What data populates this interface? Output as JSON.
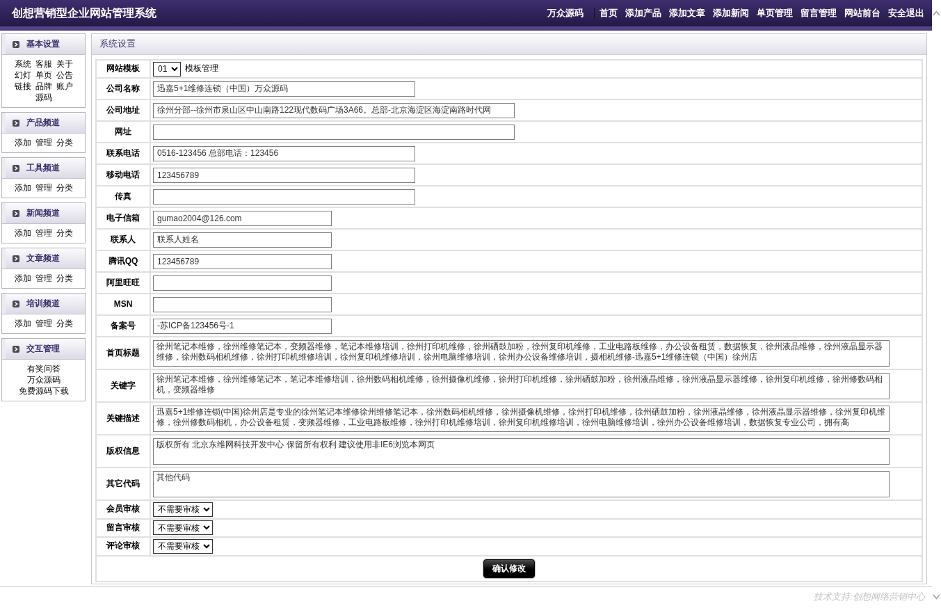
{
  "header": {
    "title": "创想营销型企业网站管理系统",
    "site_link": "万众源码",
    "nav": [
      "首页",
      "添加产品",
      "添加文章",
      "添加新闻",
      "单页管理",
      "留言管理",
      "网站前台",
      "安全退出"
    ]
  },
  "sidebar": [
    {
      "title": "基本设置",
      "links": [
        "系统",
        "客服",
        "关于",
        "幻灯",
        "单页",
        "公告",
        "链接",
        "品牌",
        "账户",
        "源码"
      ]
    },
    {
      "title": "产品频道",
      "links": [
        "添加",
        "管理",
        "分类"
      ]
    },
    {
      "title": "工具频道",
      "links": [
        "添加",
        "管理",
        "分类"
      ]
    },
    {
      "title": "新闻频道",
      "links": [
        "添加",
        "管理",
        "分类"
      ]
    },
    {
      "title": "文章频道",
      "links": [
        "添加",
        "管理",
        "分类"
      ]
    },
    {
      "title": "培训频道",
      "links": [
        "添加",
        "管理",
        "分类"
      ]
    },
    {
      "title": "交互管理",
      "links": [
        "有奖问答",
        "万众源码",
        "免费源码下载"
      ]
    }
  ],
  "panel": {
    "title": "系统设置",
    "fields": [
      {
        "label": "网站模板",
        "kind": "select",
        "value": "01",
        "link": "模板管理"
      },
      {
        "label": "公司名称",
        "kind": "input",
        "value": "迅嘉5+1维修连锁（中国）万众源码"
      },
      {
        "label": "公司地址",
        "kind": "input",
        "value": "徐州分部--徐州市泉山区中山南路122现代数码广场3A66。总部-北京海淀区海淀南路时代网"
      },
      {
        "label": "网址",
        "kind": "input"
      },
      {
        "label": "联系电话",
        "kind": "input",
        "value": "0516-123456 总部电话：123456"
      },
      {
        "label": "移动电话",
        "kind": "input",
        "value": "123456789"
      },
      {
        "label": "传真",
        "kind": "input"
      },
      {
        "label": "电子信箱",
        "kind": "input",
        "value": "gumao2004@126.com"
      },
      {
        "label": "联系人",
        "kind": "input",
        "value": "联系人姓名"
      },
      {
        "label": "腾讯QQ",
        "kind": "input",
        "value": "123456789"
      },
      {
        "label": "阿里旺旺",
        "kind": "input"
      },
      {
        "label": "MSN",
        "kind": "input"
      },
      {
        "label": "备案号",
        "kind": "input",
        "value": "-苏ICP备123456号-1"
      },
      {
        "label": "首页标题",
        "kind": "textarea",
        "value": "徐州笔记本维修，徐州维修笔记本，变频器维修，笔记本维修培训，徐州打印机维修，徐州硒鼓加粉，徐州复印机维修，工业电路板维修，办公设备租赁，数据恢复，徐州液晶维修，徐州液晶显示器维修，徐州数码相机维修，徐州打印机维修培训，徐州复印机维修培训，徐州电脑维修培训，徐州办公设备维修培训，摄相机维修-迅嘉5+1维修连锁（中国）徐州店"
      },
      {
        "label": "关键字",
        "kind": "textarea",
        "value": "徐州笔记本维修，徐州维修笔记本，笔记本维修培训，徐州数码相机维修，徐州摄像机维修，徐州打印机维修，徐州硒鼓加粉，徐州液晶维修，徐州液晶显示器维修，徐州复印机维修，徐州修数码相机，变频器维修"
      },
      {
        "label": "关键描述",
        "kind": "textarea",
        "value": "迅嘉5+1维修连锁(中国)徐州店是专业的徐州笔记本维修徐州维修笔记本，徐州数码相机维修，徐州摄像机维修，徐州打印机维修，徐州硒鼓加粉，徐州液晶维修，徐州液晶显示器维修，徐州复印机维修，徐州修数码相机，办公设备租赁，变频器维修，工业电路板维修，徐州打印机维修培训，徐州复印机维修培训，徐州电脑维修培训，徐州办公设备维修培训，数据恢复专业公司，拥有高"
      },
      {
        "label": "版权信息",
        "kind": "textarea",
        "value": "版权所有 北京东维网科技开发中心 保留所有权利 建议使用非IE6浏览本网页"
      },
      {
        "label": "其它代码",
        "kind": "textarea",
        "value": "其他代码"
      },
      {
        "label": "会员审核",
        "kind": "select",
        "value": "不需要审核"
      },
      {
        "label": "留言审核",
        "kind": "select",
        "value": "不需要审核"
      },
      {
        "label": "评论审核",
        "kind": "select",
        "value": "不需要审核"
      }
    ],
    "submit": "确认修改"
  },
  "footer": "技术支持:创想网络营销中心"
}
